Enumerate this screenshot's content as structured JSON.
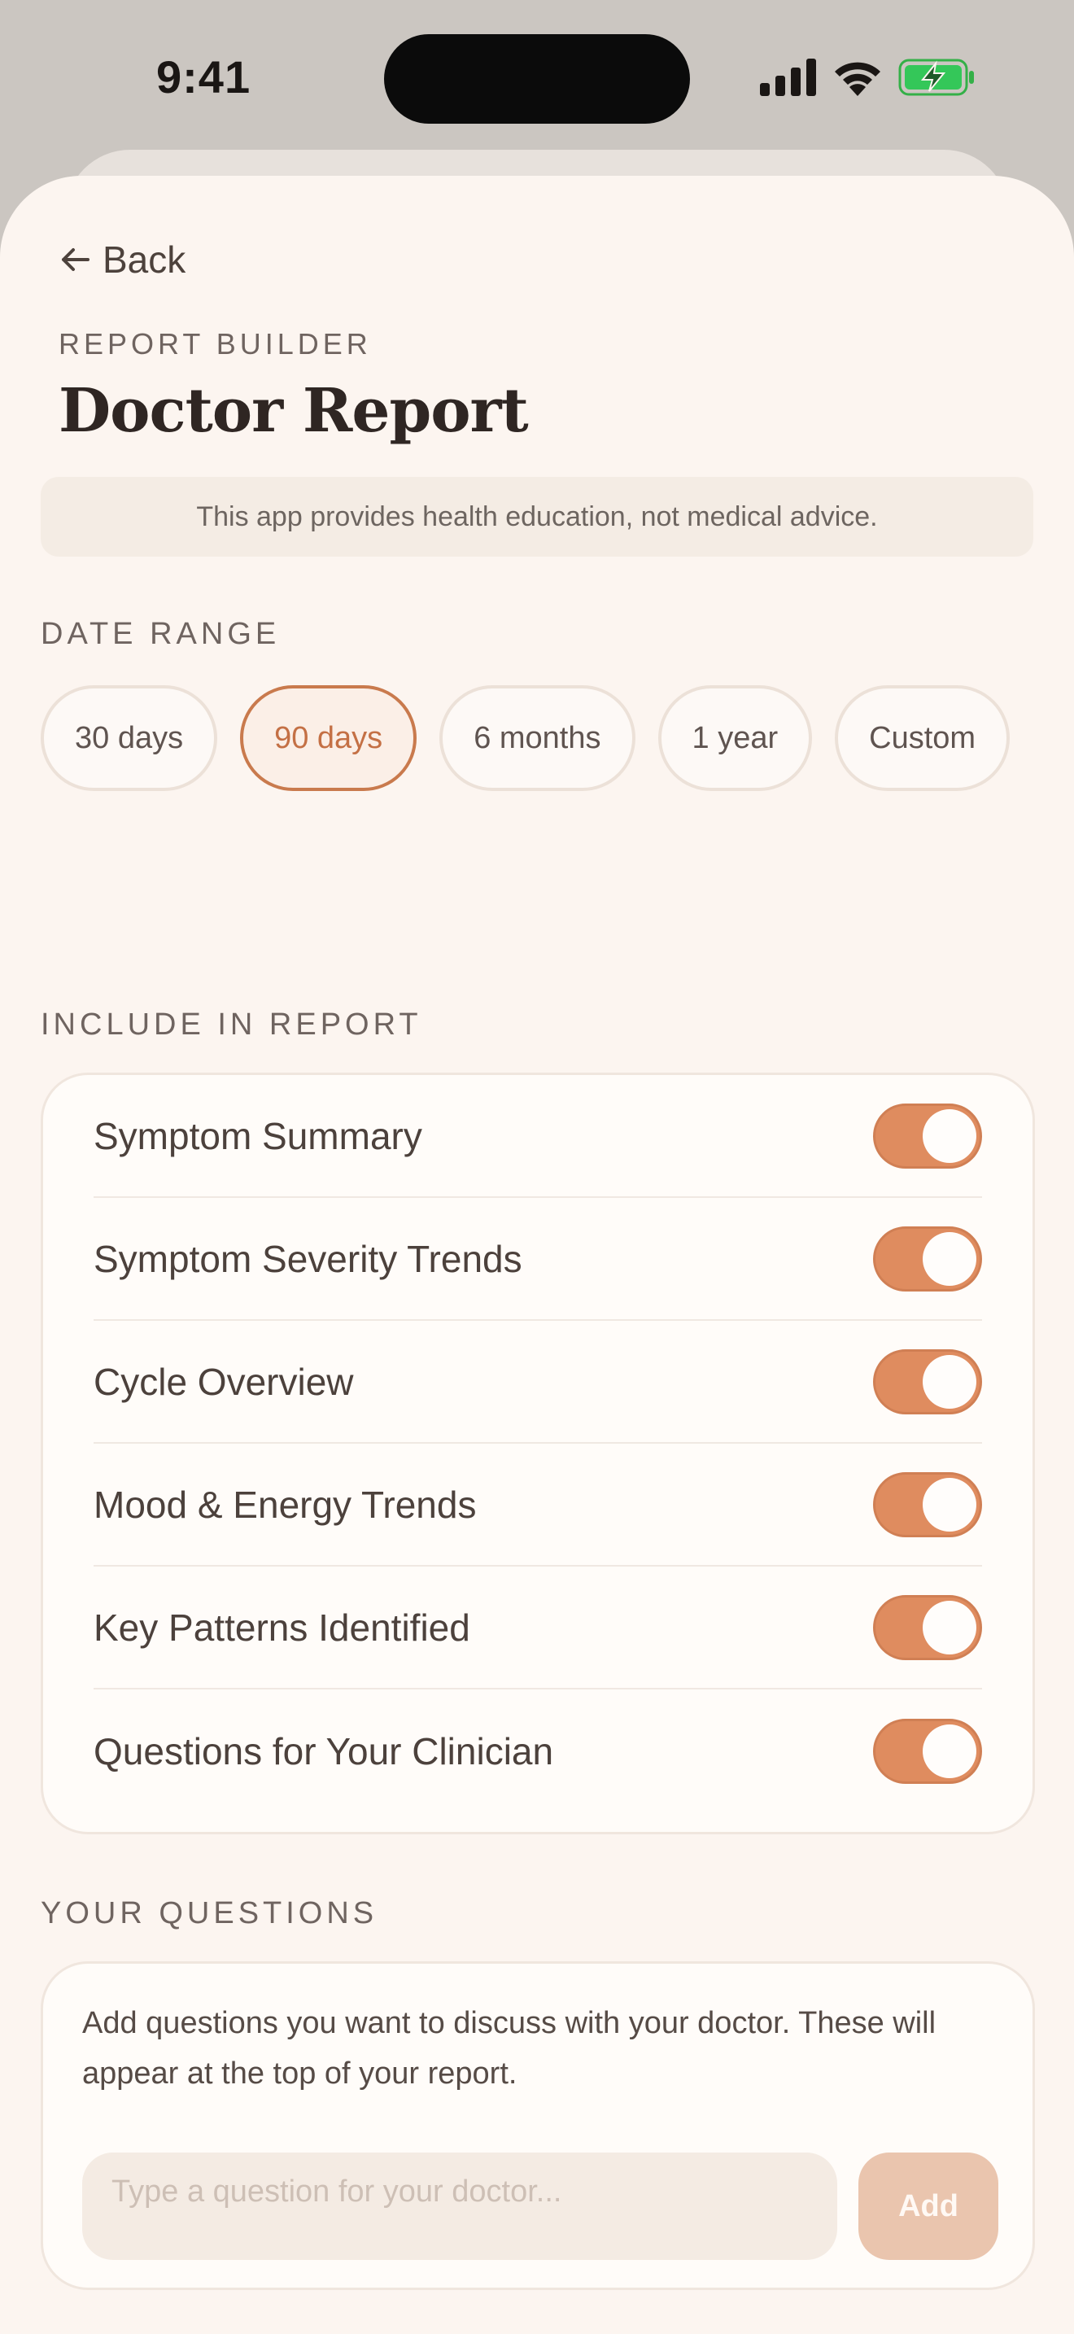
{
  "status_bar": {
    "time": "9:41"
  },
  "header": {
    "back_label": "Back",
    "eyebrow": "REPORT BUILDER",
    "title": "Doctor Report"
  },
  "disclaimer": "This app provides health education, not medical advice.",
  "date_range": {
    "label": "DATE RANGE",
    "options": [
      "30 days",
      "90 days",
      "6 months",
      "1 year",
      "Custom"
    ],
    "selected": "90 days"
  },
  "include": {
    "label": "INCLUDE IN REPORT",
    "items": [
      {
        "label": "Symptom Summary",
        "on": true
      },
      {
        "label": "Symptom Severity Trends",
        "on": true
      },
      {
        "label": "Cycle Overview",
        "on": true
      },
      {
        "label": "Mood & Energy Trends",
        "on": true
      },
      {
        "label": "Key Patterns Identified",
        "on": true
      },
      {
        "label": "Questions for Your Clinician",
        "on": true
      }
    ]
  },
  "questions": {
    "label": "YOUR QUESTIONS",
    "description": "Add questions you want to discuss with your doctor. These will appear at the top of your report.",
    "input_placeholder": "Type a question for your doctor...",
    "input_value": "",
    "add_label": "Add"
  },
  "colors": {
    "accent": "#df8c5f",
    "accent_text": "#c47045",
    "sheet_bg": "#fcf5f0",
    "add_button": "#eac5ae"
  }
}
